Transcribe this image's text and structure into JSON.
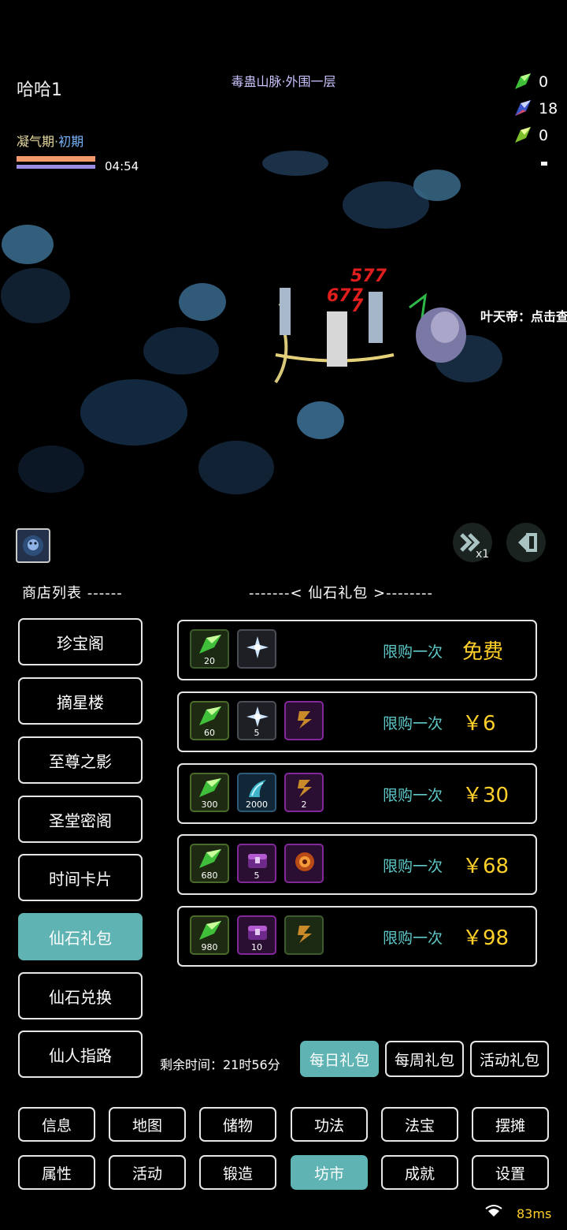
{
  "hud": {
    "player_name": "哈哈1",
    "map_name": "毒蛊山脉·外围一层",
    "realm_stage": "凝气期",
    "realm_sep": "·",
    "realm_sub": "初期",
    "timer": "04:54",
    "resources": [
      {
        "icon": "green-crystal-icon",
        "value": "0"
      },
      {
        "icon": "blue-crystal-icon",
        "value": "18"
      },
      {
        "icon": "lime-crystal-icon",
        "value": "0"
      }
    ]
  },
  "scene": {
    "damage_numbers": [
      "577",
      "677",
      "7"
    ],
    "npc_text": "叶天帝：点击查"
  },
  "controls": {
    "speed_label": "x1"
  },
  "shop": {
    "list_title": "商店列表 ------",
    "package_title": "-------< 仙石礼包 >--------",
    "categories": [
      "珍宝阁",
      "摘星楼",
      "至尊之影",
      "圣堂密阁",
      "时间卡片",
      "仙石礼包",
      "仙石兑换",
      "仙人指路"
    ],
    "active_category": "仙石礼包",
    "packages": [
      {
        "items": [
          {
            "icon": "green-crystal-icon",
            "qty": "20"
          },
          {
            "icon": "star-burst-icon",
            "qty": ""
          }
        ],
        "limit": "限购一次",
        "price": "免费"
      },
      {
        "items": [
          {
            "icon": "green-crystal-icon",
            "qty": "60"
          },
          {
            "icon": "star-burst-icon",
            "qty": "5"
          },
          {
            "icon": "scroll-icon",
            "qty": ""
          }
        ],
        "limit": "限购一次",
        "price": "￥6"
      },
      {
        "items": [
          {
            "icon": "green-crystal-icon",
            "qty": "300"
          },
          {
            "icon": "blue-wing-icon",
            "qty": "2000"
          },
          {
            "icon": "scroll-icon",
            "qty": "2"
          }
        ],
        "limit": "限购一次",
        "price": "￥30"
      },
      {
        "items": [
          {
            "icon": "green-crystal-icon",
            "qty": "680"
          },
          {
            "icon": "purple-chest-icon",
            "qty": "5"
          },
          {
            "icon": "fire-orb-icon",
            "qty": ""
          }
        ],
        "limit": "限购一次",
        "price": "￥68"
      },
      {
        "items": [
          {
            "icon": "green-crystal-icon",
            "qty": "980"
          },
          {
            "icon": "purple-chest-icon",
            "qty": "10"
          },
          {
            "icon": "scroll-icon",
            "qty": ""
          }
        ],
        "limit": "限购一次",
        "price": "￥98"
      }
    ],
    "remaining_time": "剩余时间：21时56分",
    "tabs": [
      "每日礼包",
      "每周礼包",
      "活动礼包"
    ],
    "active_tab": "每日礼包"
  },
  "menu": {
    "row1": [
      "信息",
      "地图",
      "储物",
      "功法",
      "法宝",
      "摆摊"
    ],
    "row2": [
      "属性",
      "活动",
      "锻造",
      "坊市",
      "成就",
      "设置"
    ],
    "active": "坊市"
  },
  "status": {
    "ping": "83ms"
  }
}
